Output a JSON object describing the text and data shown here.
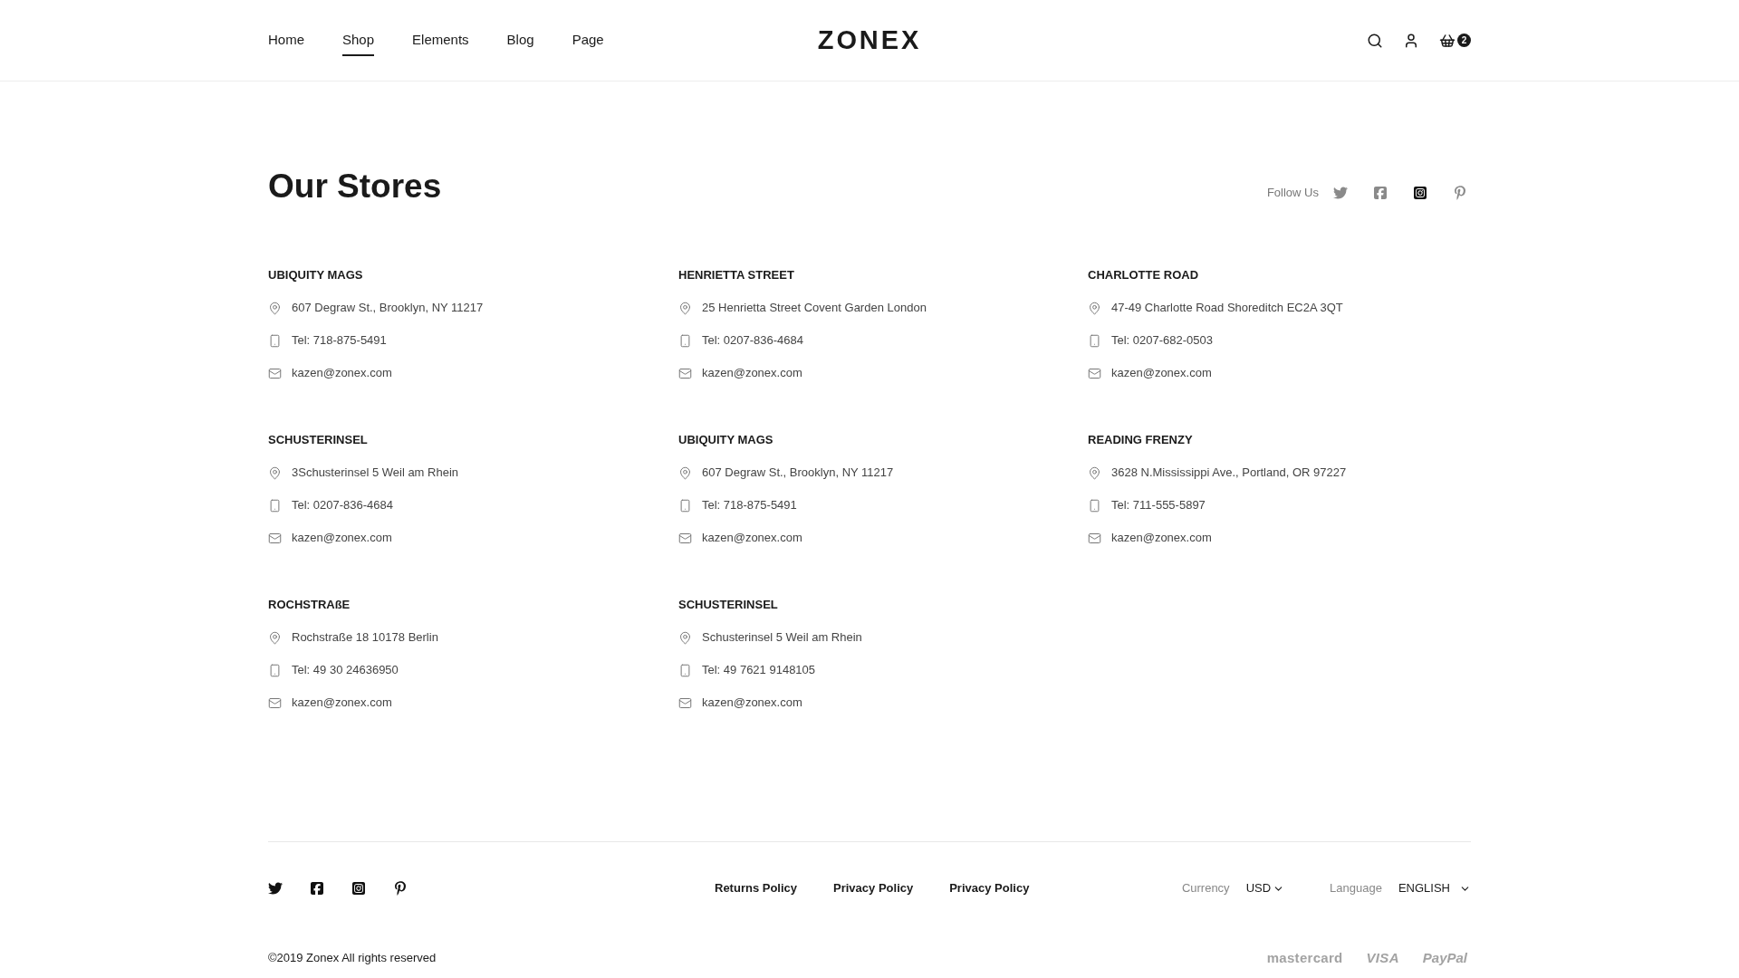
{
  "header": {
    "nav": [
      {
        "label": "Home",
        "selected": false
      },
      {
        "label": "Shop",
        "selected": true
      },
      {
        "label": "Elements",
        "selected": false
      },
      {
        "label": "Blog",
        "selected": false
      },
      {
        "label": "Page",
        "selected": false
      }
    ],
    "logo": "ZONEX",
    "cart_count": "2"
  },
  "stores_section": {
    "title": "Our Stores",
    "follow_label": "Follow Us",
    "social": [
      {
        "kind": "twitter",
        "highlighted": false
      },
      {
        "kind": "facebook",
        "highlighted": false
      },
      {
        "kind": "instagram",
        "highlighted": true
      },
      {
        "kind": "pinterest",
        "highlighted": false
      }
    ]
  },
  "stores": [
    {
      "name": "UBIQUITY MAGS",
      "address": "607 Degraw St., Brooklyn, NY 11217",
      "phone": "Tel: 718-875-5491",
      "email": "kazen@zonex.com"
    },
    {
      "name": "HENRIETTA STREET",
      "address": "25 Henrietta Street Covent Garden London",
      "phone": "Tel: 0207-836-4684",
      "email": "kazen@zonex.com"
    },
    {
      "name": "CHARLOTTE ROAD",
      "address": "47-49 Charlotte Road Shoreditch EC2A 3QT",
      "phone": "Tel: 0207-682-0503",
      "email": "kazen@zonex.com"
    },
    {
      "name": "SCHUSTERINSEL",
      "address": "3Schusterinsel 5 Weil am Rhein",
      "phone": "Tel: 0207-836-4684",
      "email": "kazen@zonex.com"
    },
    {
      "name": "UBIQUITY MAGS",
      "address": "607 Degraw St., Brooklyn, NY 11217",
      "phone": "Tel: 718-875-5491",
      "email": "kazen@zonex.com"
    },
    {
      "name": "READING FRENZY",
      "address": "3628 N.Mississippi Ave., Portland, OR 97227",
      "phone": "Tel: 711-555-5897",
      "email": "kazen@zonex.com"
    },
    {
      "name": "ROCHSTRAßE",
      "address": "Rochstraße 18 10178 Berlin",
      "phone": "Tel: 49 30 24636950",
      "email": "kazen@zonex.com"
    },
    {
      "name": "SCHUSTERINSEL",
      "address": "Schusterinsel 5 Weil am Rhein",
      "phone": "Tel: 49 7621 9148105",
      "email": "kazen@zonex.com"
    }
  ],
  "footer": {
    "social": [
      {
        "kind": "twitter"
      },
      {
        "kind": "facebook"
      },
      {
        "kind": "instagram"
      },
      {
        "kind": "pinterest"
      }
    ],
    "links": [
      "Returns Policy",
      "Privacy Policy",
      "Privacy Policy"
    ],
    "currency": {
      "label": "Currency",
      "value": "USD"
    },
    "language": {
      "label": "Language",
      "value": "ENGLISH"
    },
    "copyright": "©2019 Zonex All rights reserved",
    "payments": [
      {
        "kind": "mastercard",
        "label": "mastercard"
      },
      {
        "kind": "visa",
        "label": "VISA"
      },
      {
        "kind": "paypal",
        "label": "PayPal"
      }
    ]
  }
}
